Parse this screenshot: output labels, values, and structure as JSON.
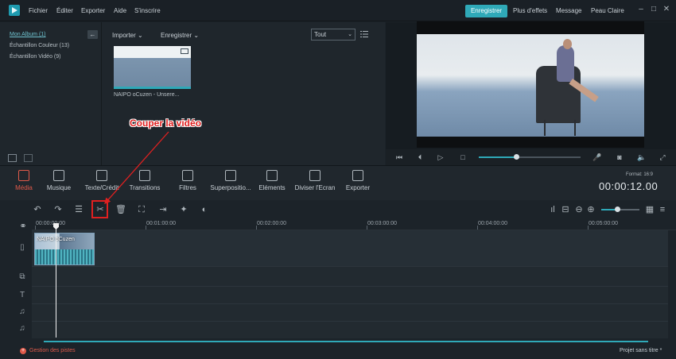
{
  "menu": [
    "Fichier",
    "Éditer",
    "Exporter",
    "Aide",
    "S'inscrire"
  ],
  "top_right": {
    "register_btn": "Enregistrer",
    "more_effects": "Plus d'effets",
    "message": "Message",
    "user": "Peau Claire"
  },
  "library": {
    "items": [
      "Mon Album (1)",
      "Échantillon Couleur (13)",
      "Échantillon Vidéo (9)"
    ],
    "import_label": "Importer",
    "record_label": "Enregistrer",
    "filter_value": "Tout",
    "media_label": "NAIPO oCuzen - Unsere..."
  },
  "tabs": [
    "Média",
    "Musique",
    "Texte/Crédit",
    "Transitions",
    "Filtres",
    "Superpositio...",
    "Eléments",
    "Diviser l'Ecran",
    "Exporter"
  ],
  "format": "Format: 16:9",
  "timecode": "00:00:12.00",
  "ruler": [
    "00:00:00:00",
    "00:01:00:00",
    "00:02:00:00",
    "00:03:00:00",
    "00:04:00:00",
    "00:05:00:00"
  ],
  "clip_label": "NAIPO oCuzen",
  "footer": {
    "track_mgmt": "Gestion des pistes",
    "project": "Projet sans titre *"
  },
  "annotation": "Couper la vidéo",
  "colors": {
    "accent": "#2fa9b8",
    "active_tab": "#e05a4a",
    "annotation": "#e02020"
  }
}
